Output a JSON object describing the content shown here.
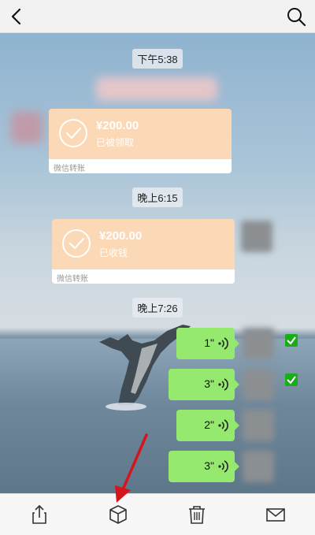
{
  "times": [
    "下午5:38",
    "晚上6:15",
    "晚上7:26"
  ],
  "transfers": [
    {
      "amount": "¥200.00",
      "status": "已被领取",
      "footer": "微信转账"
    },
    {
      "amount": "¥200.00",
      "status": "已收钱",
      "footer": "微信转账"
    }
  ],
  "voices": [
    "1\"",
    "3\"",
    "2\"",
    "3\""
  ],
  "voice_selected": [
    true,
    true,
    false,
    false
  ],
  "toolbar": [
    "share-icon",
    "box-icon",
    "trash-icon",
    "mail-icon"
  ],
  "colors": {
    "voice_bubble": "#95e96e",
    "transfer_bubble": "#fbd9b6",
    "checkbox": "#1aad19",
    "arrow": "#d4151b"
  }
}
